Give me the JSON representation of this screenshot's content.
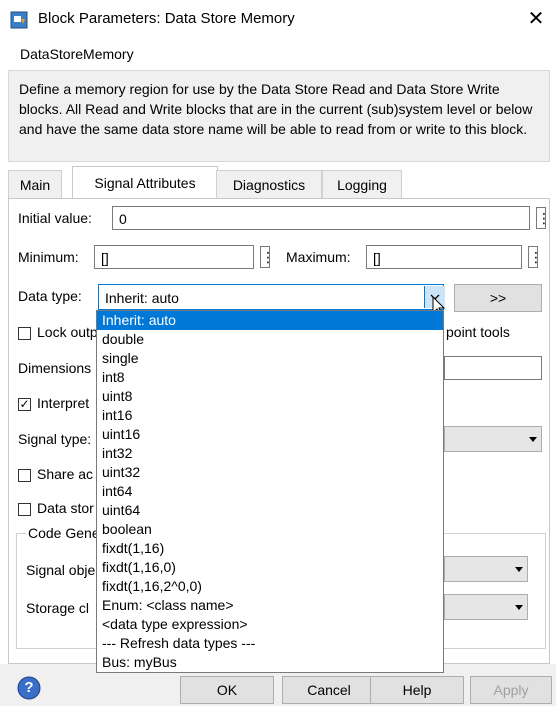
{
  "window": {
    "title": "Block Parameters: Data Store Memory",
    "close_glyph": "✕"
  },
  "block": {
    "name": "DataStoreMemory",
    "description": "Define a memory region for use by the Data Store Read and Data Store Write blocks. All Read and Write blocks that are in the current (sub)system level or below and have the same data store name will be able to read from or write to this block."
  },
  "tabs": [
    {
      "label": "Main",
      "active": false
    },
    {
      "label": "Signal Attributes",
      "active": true
    },
    {
      "label": "Diagnostics",
      "active": false
    },
    {
      "label": "Logging",
      "active": false
    }
  ],
  "fields": {
    "initial_value_label": "Initial value:",
    "initial_value": "0",
    "minimum_label": "Minimum:",
    "minimum_value": "[]",
    "maximum_label": "Maximum:",
    "maximum_value": "[]",
    "more_glyph": "⋮",
    "data_type_label": "Data type:",
    "data_type_value": "Inherit: auto",
    "assistant_button": ">>",
    "lock_label_visible": "Lock outp",
    "lock_label_tail": "point tools",
    "dimensions_label": "Dimensions",
    "interpret_label": "Interpret",
    "interpret_checked": true,
    "signal_type_label": "Signal type:",
    "share_label": "Share ac",
    "data_store_label": "Data stor",
    "code_gen_label": "Code Gene",
    "signal_object_label": "Signal obje",
    "storage_class_label": "Storage cl"
  },
  "dropdown": {
    "options": [
      "Inherit: auto",
      "double",
      "single",
      "int8",
      "uint8",
      "int16",
      "uint16",
      "int32",
      "uint32",
      "int64",
      "uint64",
      "boolean",
      "fixdt(1,16)",
      "fixdt(1,16,0)",
      "fixdt(1,16,2^0,0)",
      "Enum: <class name>",
      "<data type expression>",
      "--- Refresh data types ---",
      "Bus: myBus"
    ],
    "selected_index": 0
  },
  "footer": {
    "help_icon_glyph": "?",
    "ok_label": "OK",
    "cancel_label": "Cancel",
    "help_label": "Help",
    "apply_label": "Apply"
  },
  "colors": {
    "selection": "#0078d7",
    "panel_bg": "#f0f0f0"
  }
}
